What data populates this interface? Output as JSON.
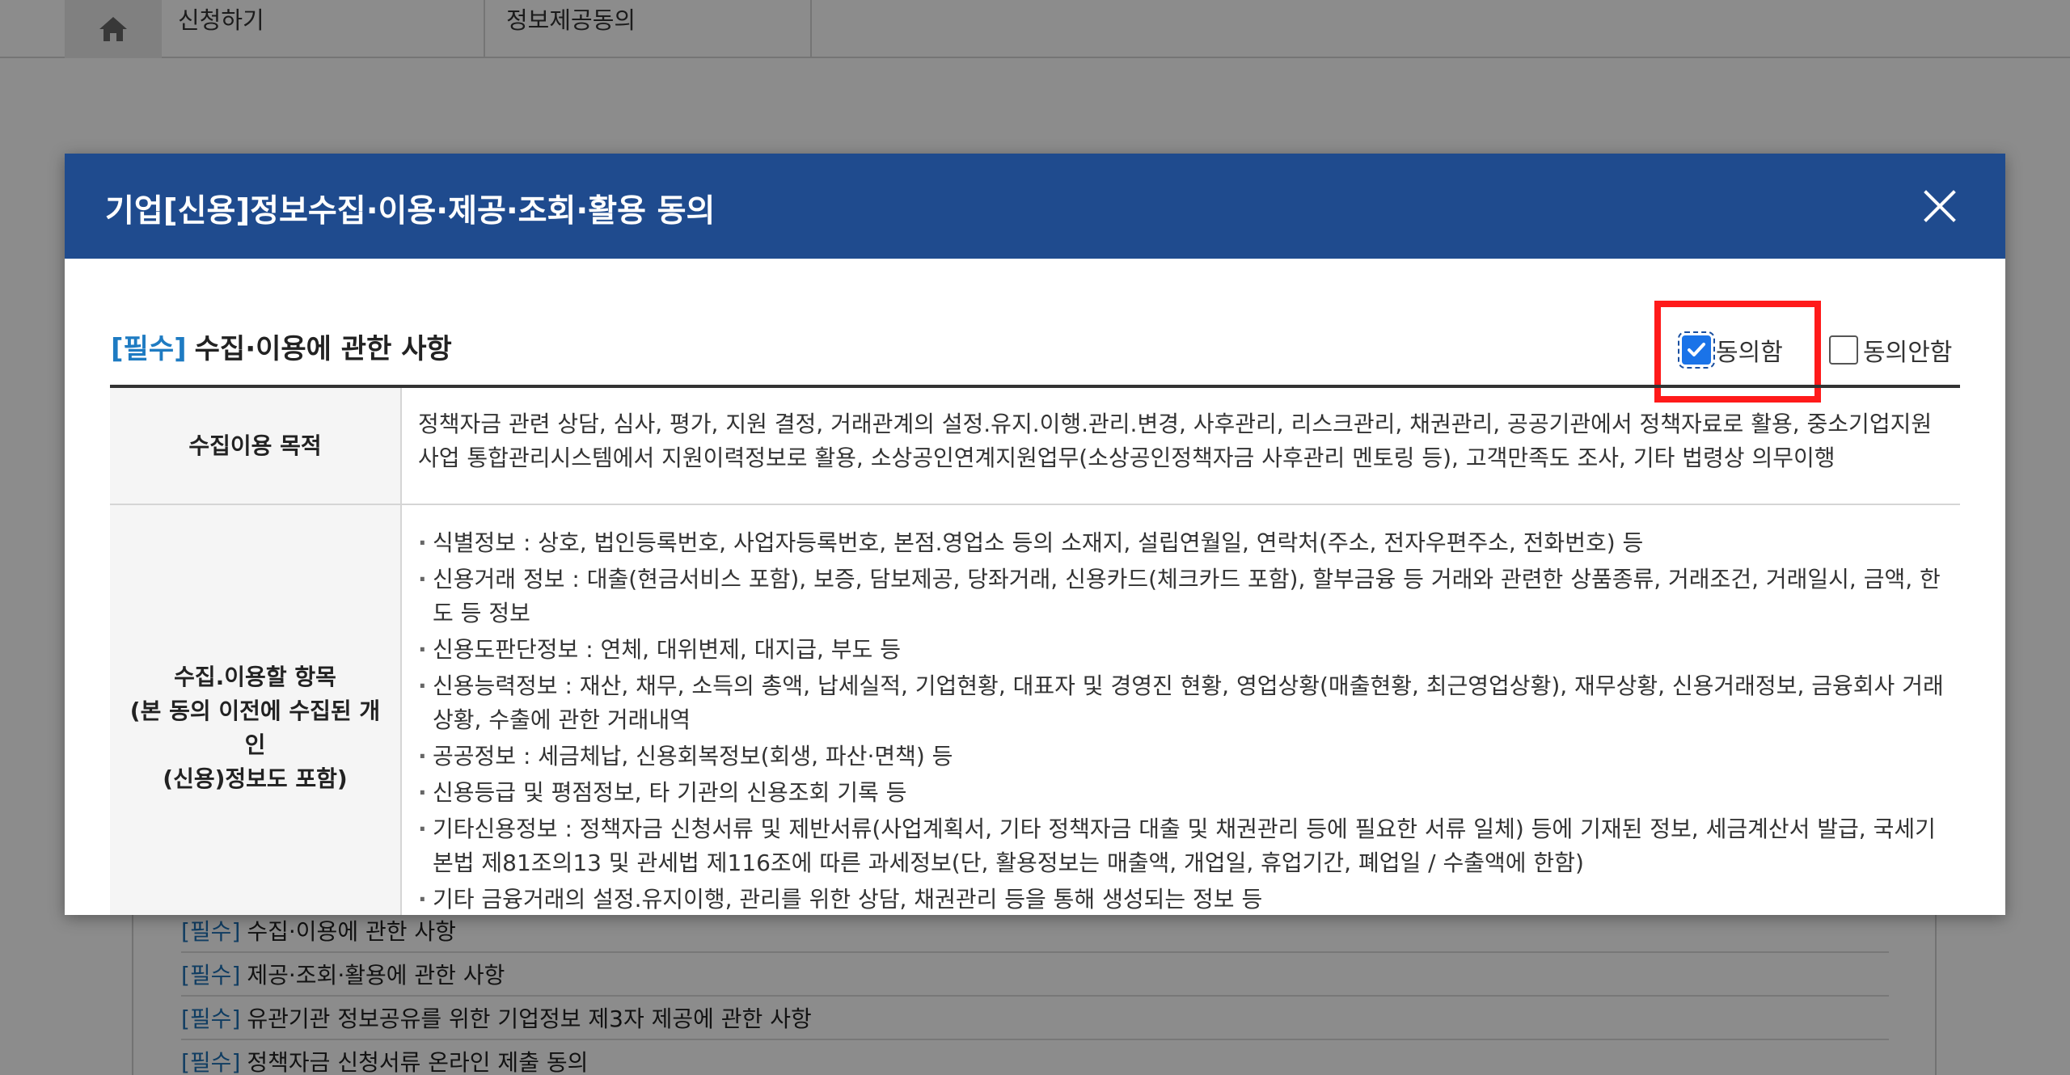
{
  "background": {
    "breadcrumb": [
      "신청하기",
      "정보제공동의"
    ],
    "list_items": [
      {
        "tag": "[필수]",
        "text": "수집·이용에 관한 사항"
      },
      {
        "tag": "[필수]",
        "text": "제공·조회·활용에 관한 사항"
      },
      {
        "tag": "[필수]",
        "text": "유관기관 정보공유를 위한 기업정보 제3자 제공에 관한 사항"
      },
      {
        "tag": "[필수]",
        "text": "정책자금 신청서류 온라인 제출 동의"
      }
    ]
  },
  "modal": {
    "title": "기업[신용]정보수집·이용·제공·조회·활용 동의",
    "section": {
      "tag": "[필수]",
      "title": "수집·이용에 관한 사항"
    },
    "consent": {
      "agree_label": "동의함",
      "disagree_label": "동의안함",
      "agree_checked": true,
      "disagree_checked": false
    },
    "table": {
      "purpose_header": "수집이용 목적",
      "purpose_text": "정책자금 관련 상담, 심사, 평가, 지원 결정, 거래관계의 설정.유지.이행.관리.변경, 사후관리, 리스크관리, 채권관리, 공공기관에서 정책자료로 활용, 중소기업지원사업 통합관리시스템에서 지원이력정보로 활용, 소상공인연계지원업무(소상공인정책자금 사후관리 멘토링 등), 고객만족도 조사, 기타 법령상 의무이행",
      "items_header_lines": [
        "수집.이용할 항목",
        "(본 동의 이전에 수집된 개인",
        "(신용)정보도 포함)"
      ],
      "items": [
        "식별정보 : 상호, 법인등록번호, 사업자등록번호, 본점.영업소 등의 소재지, 설립연월일, 연락처(주소, 전자우편주소, 전화번호) 등",
        "신용거래 정보 : 대출(현금서비스 포함), 보증, 담보제공, 당좌거래, 신용카드(체크카드 포함), 할부금융 등 거래와 관련한 상품종류, 거래조건, 거래일시, 금액, 한도 등 정보",
        "신용도판단정보 : 연체, 대위변제, 대지급, 부도 등",
        "신용능력정보 : 재산, 채무, 소득의 총액, 납세실적, 기업현황, 대표자 및 경영진 현황, 영업상황(매출현황, 최근영업상황), 재무상황, 신용거래정보, 금융회사 거래상황, 수출에 관한 거래내역",
        "공공정보 : 세금체납, 신용회복정보(회생, 파산·면책) 등",
        "신용등급 및 평점정보, 타 기관의 신용조회 기록 등",
        "기타신용정보 : 정책자금 신청서류 및 제반서류(사업계획서, 기타 정책자금 대출 및 채권관리 등에 필요한 서류 일체) 등에 기재된 정보, 세금계산서 발급, 국세기본법 제81조의13 및 관세법 제116조에 따른 과세정보(단, 활용정보는 매출액, 개업일, 휴업기간, 폐업일 / 수출액에 한함)",
        "기타 금융거래의 설정.유지이행, 관리를 위한 상담, 채권관리 등을 통해 생성되는 정보 등"
      ]
    }
  }
}
